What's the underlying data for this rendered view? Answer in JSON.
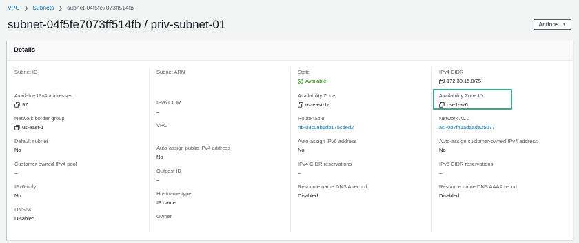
{
  "breadcrumb": {
    "items": [
      "VPC",
      "Subnets",
      "subnet-04f5fe7073ff514fb"
    ]
  },
  "page": {
    "title": "subnet-04f5fe7073ff514fb / priv-subnet-01",
    "actions_label": "Actions"
  },
  "details": {
    "title": "Details",
    "col1": [
      {
        "label": "Subnet ID",
        "value": ""
      },
      {
        "label": "Available IPv4 addresses",
        "value": "97"
      },
      {
        "label": "Network border group",
        "value": "us-east-1"
      },
      {
        "label": "Default subnet",
        "value": "No"
      },
      {
        "label": "Customer-owned IPv4 pool",
        "value": "–"
      },
      {
        "label": "IPv6-only",
        "value": "No"
      },
      {
        "label": "DNS64",
        "value": "Disabled"
      }
    ],
    "col2": [
      {
        "label": "Subnet ARN",
        "value": ""
      },
      {
        "label": "IPv6 CIDR",
        "value": "–"
      },
      {
        "label": "VPC",
        "value": ""
      },
      {
        "label": "Auto-assign public IPv4 address",
        "value": "No"
      },
      {
        "label": "Outpost ID",
        "value": "–"
      },
      {
        "label": "Hostname type",
        "value": "IP name"
      },
      {
        "label": "Owner",
        "value": ""
      }
    ],
    "col3": [
      {
        "label": "State",
        "value": "Available"
      },
      {
        "label": "Availability Zone",
        "value": "us-east-1a"
      },
      {
        "label": "Route table",
        "value": "rtb-08c08b5db175cded2"
      },
      {
        "label": "Auto-assign IPv6 address",
        "value": "No"
      },
      {
        "label": "IPv4 CIDR reservations",
        "value": "–"
      },
      {
        "label": "Resource name DNS A record",
        "value": "Disabled"
      }
    ],
    "col4": [
      {
        "label": "IPv4 CIDR",
        "value": "172.30.15.0/25"
      },
      {
        "label": "Availability Zone ID",
        "value": "use1-az6"
      },
      {
        "label": "Network ACL",
        "value": "acl-0b7f41adaade25077"
      },
      {
        "label": "Auto-assign customer-owned IPv4 address",
        "value": "No"
      },
      {
        "label": "IPv6 CIDR reservations",
        "value": "–"
      },
      {
        "label": "Resource name DNS AAAA record",
        "value": "Disabled"
      }
    ]
  },
  "colors": {
    "link": "#0073bb",
    "success": "#1d8102",
    "highlight": "#3aa88b"
  },
  "icons": {
    "copy": "copy-icon",
    "status": "check-circle-icon",
    "breadcrumb_sep": "chevron-right-icon",
    "actions_caret": "caret-down-icon"
  }
}
